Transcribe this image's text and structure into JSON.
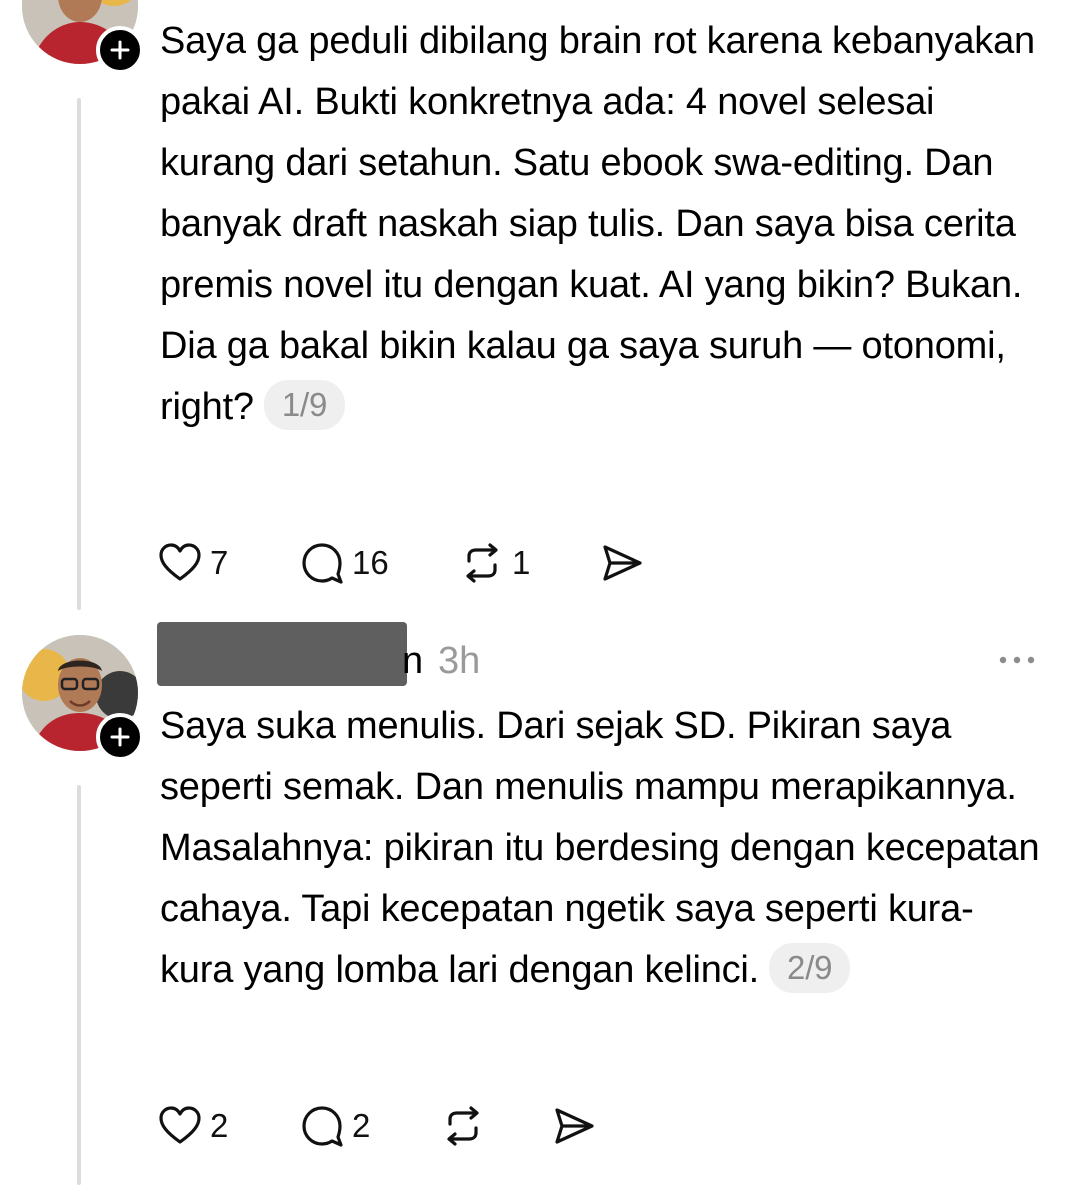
{
  "posts": [
    {
      "text": "Saya ga peduli dibilang brain rot karena kebanyakan pakai AI. Bukti konkretnya ada: 4 novel selesai kurang dari setahun. Satu ebook swa-editing. Dan banyak draft naskah siap tulis. Dan saya bisa cerita premis novel itu dengan kuat. AI yang bikin? Bukan. Dia ga bakal bikin kalau ga saya suruh — otonomi, right?",
      "pager": "1/9",
      "likes": "7",
      "replies": "16",
      "reposts": "1"
    },
    {
      "username_tail": "n",
      "time": "3h",
      "text": "Saya suka menulis. Dari sejak SD. Pikiran saya seperti semak. Dan menulis mampu merapikannya. Masalahnya: pikiran itu berdesing dengan kecepatan cahaya. Tapi kecepatan ngetik saya seperti kura-kura yang lomba lari dengan kelinci.",
      "pager": "2/9",
      "likes": "2",
      "replies": "2"
    }
  ],
  "icons": {
    "like": "heart-icon",
    "reply": "comment-icon",
    "repost": "repost-icon",
    "share": "send-icon",
    "follow": "plus-icon",
    "more": "more-dots-icon"
  }
}
